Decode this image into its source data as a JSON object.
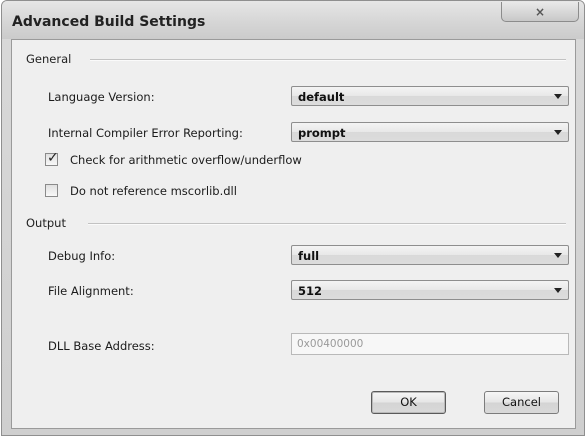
{
  "window": {
    "title": "Advanced Build Settings",
    "close_glyph": "×"
  },
  "general": {
    "label": "General",
    "language_version": {
      "label": "Language Version:",
      "value": "default"
    },
    "compiler_error_reporting": {
      "label": "Internal Compiler Error Reporting:",
      "value": "prompt"
    },
    "check_overflow": {
      "label": "Check for arithmetic overflow/underflow",
      "checked": true
    },
    "no_mscorlib": {
      "label": "Do not reference mscorlib.dll",
      "checked": false
    }
  },
  "output": {
    "label": "Output",
    "debug_info": {
      "label": "Debug Info:",
      "value": "full"
    },
    "file_alignment": {
      "label": "File Alignment:",
      "value": "512"
    },
    "dll_base_address": {
      "label": "DLL Base Address:",
      "value": "0x00400000"
    }
  },
  "buttons": {
    "ok": "OK",
    "cancel": "Cancel"
  }
}
